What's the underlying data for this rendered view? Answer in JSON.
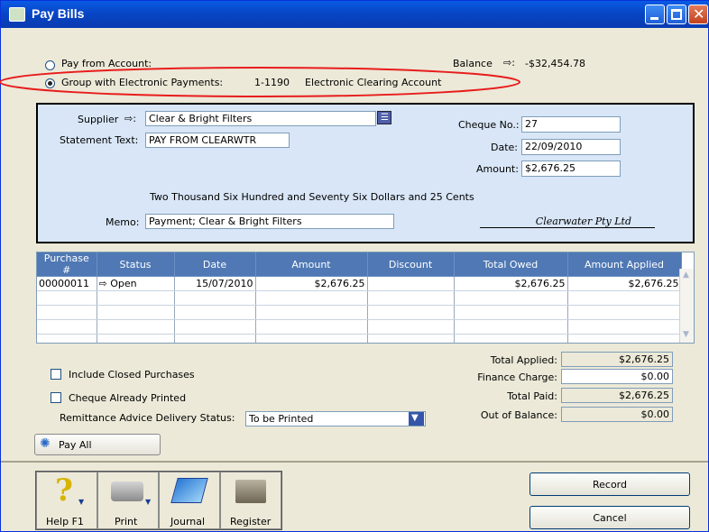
{
  "window": {
    "title": "Pay Bills"
  },
  "account": {
    "pay_from_label": "Pay from Account:",
    "group_label": "Group with Electronic Payments:",
    "account_number": "1-1190",
    "account_name": "Electronic Clearing Account",
    "balance_label": "Balance",
    "balance_value": "-$32,454.78"
  },
  "cheque": {
    "supplier_label": "Supplier",
    "supplier_value": "Clear & Bright Filters",
    "statement_label": "Statement Text:",
    "statement_value": "PAY FROM CLEARWTR",
    "cheque_no_label": "Cheque No.:",
    "cheque_no_value": "27",
    "date_label": "Date:",
    "date_value": "22/09/2010",
    "amount_label": "Amount:",
    "amount_value": "$2,676.25",
    "amount_words": "Two Thousand Six Hundred and Seventy Six Dollars and 25 Cents",
    "memo_label": "Memo:",
    "memo_value": "Payment; Clear & Bright Filters",
    "signature": "Clearwater Pty Ltd"
  },
  "table": {
    "columns": [
      "Purchase #",
      "Status",
      "Date",
      "Amount",
      "Discount",
      "Total Owed",
      "Amount Applied"
    ],
    "rows": [
      [
        "00000011",
        "Open",
        "15/07/2010",
        "$2,676.25",
        "",
        "$2,676.25",
        "$2,676.25"
      ]
    ]
  },
  "options": {
    "include_closed": "Include Closed Purchases",
    "cheque_printed": "Cheque Already Printed",
    "remittance_label": "Remittance Advice Delivery Status:",
    "remittance_value": "To be Printed"
  },
  "totals": {
    "applied_label": "Total Applied:",
    "applied_value": "$2,676.25",
    "finance_label": "Finance Charge:",
    "finance_value": "$0.00",
    "paid_label": "Total Paid:",
    "paid_value": "$2,676.25",
    "out_label": "Out of Balance:",
    "out_value": "$0.00"
  },
  "buttons": {
    "pay_all": "Pay All",
    "record": "Record",
    "cancel": "Cancel"
  },
  "toolbar": {
    "help": "Help F1",
    "print": "Print",
    "journal": "Journal",
    "register": "Register"
  },
  "colors": {
    "annotation": "#e81c1c",
    "titlebar": "#0a5be4",
    "grid_header": "#4f78b4"
  }
}
